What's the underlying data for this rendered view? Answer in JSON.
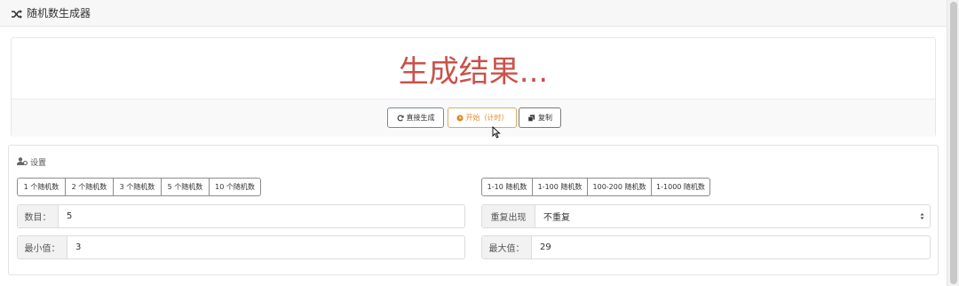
{
  "header": {
    "title": "随机数生成器",
    "icon": "shuffle-icon"
  },
  "result": {
    "text": "生成结果...",
    "color": "#c9524a"
  },
  "actions": {
    "direct_label": "直接生成",
    "start_label": "开始（计时）",
    "copy_label": "复制"
  },
  "settings": {
    "title": "设置",
    "count_presets": [
      "1 个随机数",
      "2 个随机数",
      "3 个随机数",
      "5 个随机数",
      "10 个随机数"
    ],
    "range_presets": [
      "1-10 随机数",
      "1-100 随机数",
      "100-200 随机数",
      "1-1000 随机数"
    ],
    "count": {
      "label": "数目：",
      "value": "5"
    },
    "repeat": {
      "label": "重复出现",
      "value": "不重复"
    },
    "min": {
      "label": "最小值：",
      "value": "3"
    },
    "max": {
      "label": "最大值：",
      "value": "29"
    }
  }
}
